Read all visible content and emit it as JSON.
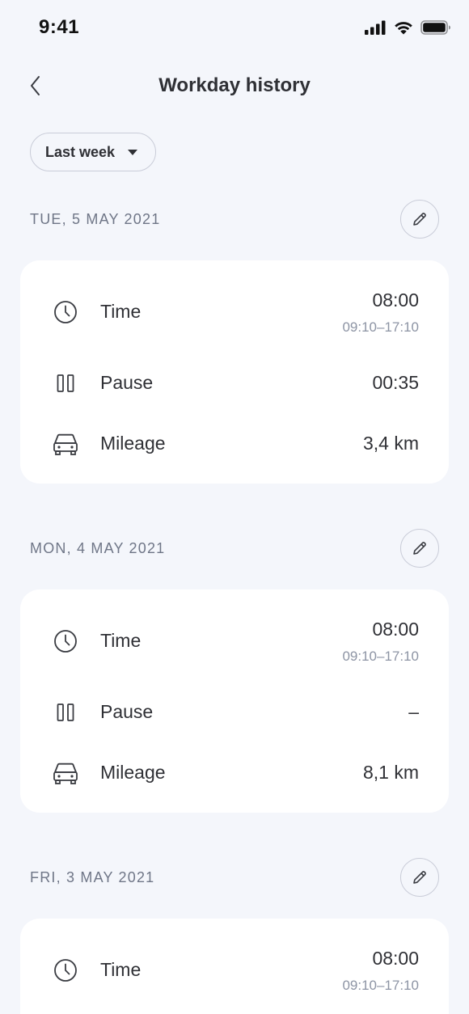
{
  "status_bar": {
    "time": "9:41"
  },
  "header": {
    "title": "Workday history"
  },
  "filter": {
    "label": "Last week"
  },
  "days": [
    {
      "date": "TUE, 5 MAY 2021",
      "time_label": "Time",
      "time_value": "08:00",
      "time_range": "09:10–17:10",
      "pause_label": "Pause",
      "pause_value": "00:35",
      "mileage_label": "Mileage",
      "mileage_value": "3,4 km"
    },
    {
      "date": "MON, 4 MAY 2021",
      "time_label": "Time",
      "time_value": "08:00",
      "time_range": "09:10–17:10",
      "pause_label": "Pause",
      "pause_value": "–",
      "mileage_label": "Mileage",
      "mileage_value": "8,1 km"
    },
    {
      "date": "FRI, 3 MAY 2021",
      "time_label": "Time",
      "time_value": "08:00",
      "time_range": "09:10–17:10"
    }
  ],
  "colors": {
    "background": "#f4f6fb",
    "card": "#ffffff",
    "text_primary": "#2f3035",
    "text_secondary": "#6f7687",
    "text_muted": "#8d94a4",
    "outline": "#c9ccd8"
  },
  "icons": [
    "back-chevron-icon",
    "clock-icon",
    "pause-icon",
    "car-icon",
    "pencil-icon",
    "signal-icon",
    "wifi-icon",
    "battery-icon",
    "caret-down-icon"
  ]
}
